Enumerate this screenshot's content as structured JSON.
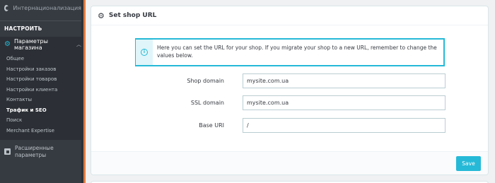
{
  "sidebar": {
    "top_item": "Интернационализация",
    "section_title": "НАСТРОИТЬ",
    "active_item": "Параметры магазина",
    "sub_items": [
      {
        "label": "Общее"
      },
      {
        "label": "Настройки заказов"
      },
      {
        "label": "Настройки товаров"
      },
      {
        "label": "Настройки клиента"
      },
      {
        "label": "Контакты"
      },
      {
        "label": "Трафик и SEO"
      },
      {
        "label": "Поиск"
      },
      {
        "label": "Merchant Expertise"
      }
    ],
    "current_sub_item": "Трафик и SEO",
    "bottom_item": "Расширенные параметры"
  },
  "panel": {
    "title": "Set shop URL",
    "info_text": "Here you can set the URL for your shop. If you migrate your shop to a new URL, remember to change the values below.",
    "fields": {
      "shop_domain": {
        "label": "Shop domain",
        "value": "mysite.com.ua"
      },
      "ssl_domain": {
        "label": "SSL domain",
        "value": "mysite.com.ua"
      },
      "base_uri": {
        "label": "Base URI",
        "value": "/"
      }
    },
    "save_label": "Save"
  },
  "colors": {
    "accent": "#25b9d7",
    "sidebar_bg": "#363a41",
    "orange_stripe": "#e07a3f"
  },
  "icons": {
    "top_item": "globe-icon",
    "active_item": "gear-icon",
    "bottom_item": "settings-icon",
    "panel_header": "gear-icon",
    "alert": "info-icon"
  }
}
